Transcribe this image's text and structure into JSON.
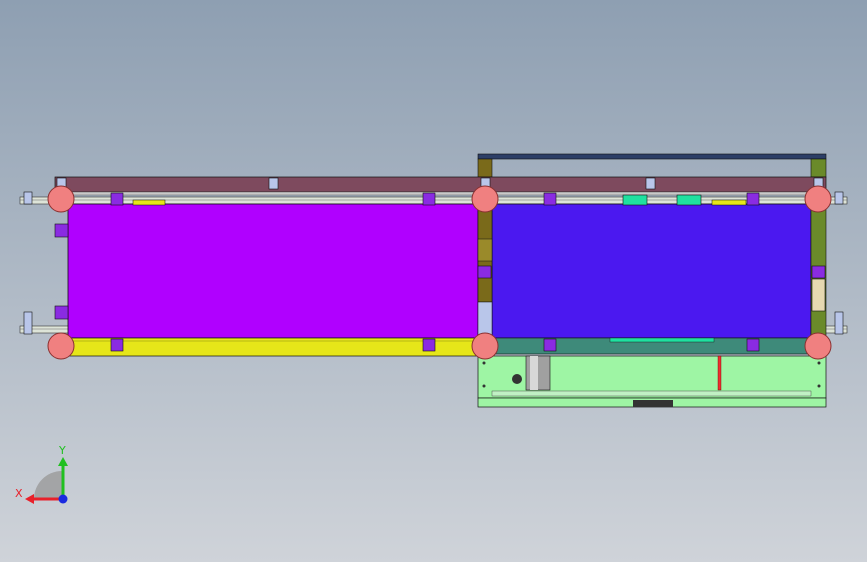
{
  "viewport": {
    "background_top": "#8e9fb2",
    "background_bottom": "#cfd3d9"
  },
  "model": {
    "left_conveyor_color": "#b000ff",
    "right_conveyor_color": "#4b18f0",
    "top_rail_color": "#7e4a5e",
    "bottom_rail_left_color": "#e6e619",
    "base_color": "#9ef5a4",
    "roller_color": "#f08080",
    "bracket_color": "#8a2be2",
    "post_color": "#7a6a1a",
    "frame_color": "#2c3e66"
  },
  "triad": {
    "x_label": "X",
    "y_label": "Y",
    "x_color": "#e8202a",
    "y_color": "#20c020",
    "z_color": "#1a2ae0"
  }
}
